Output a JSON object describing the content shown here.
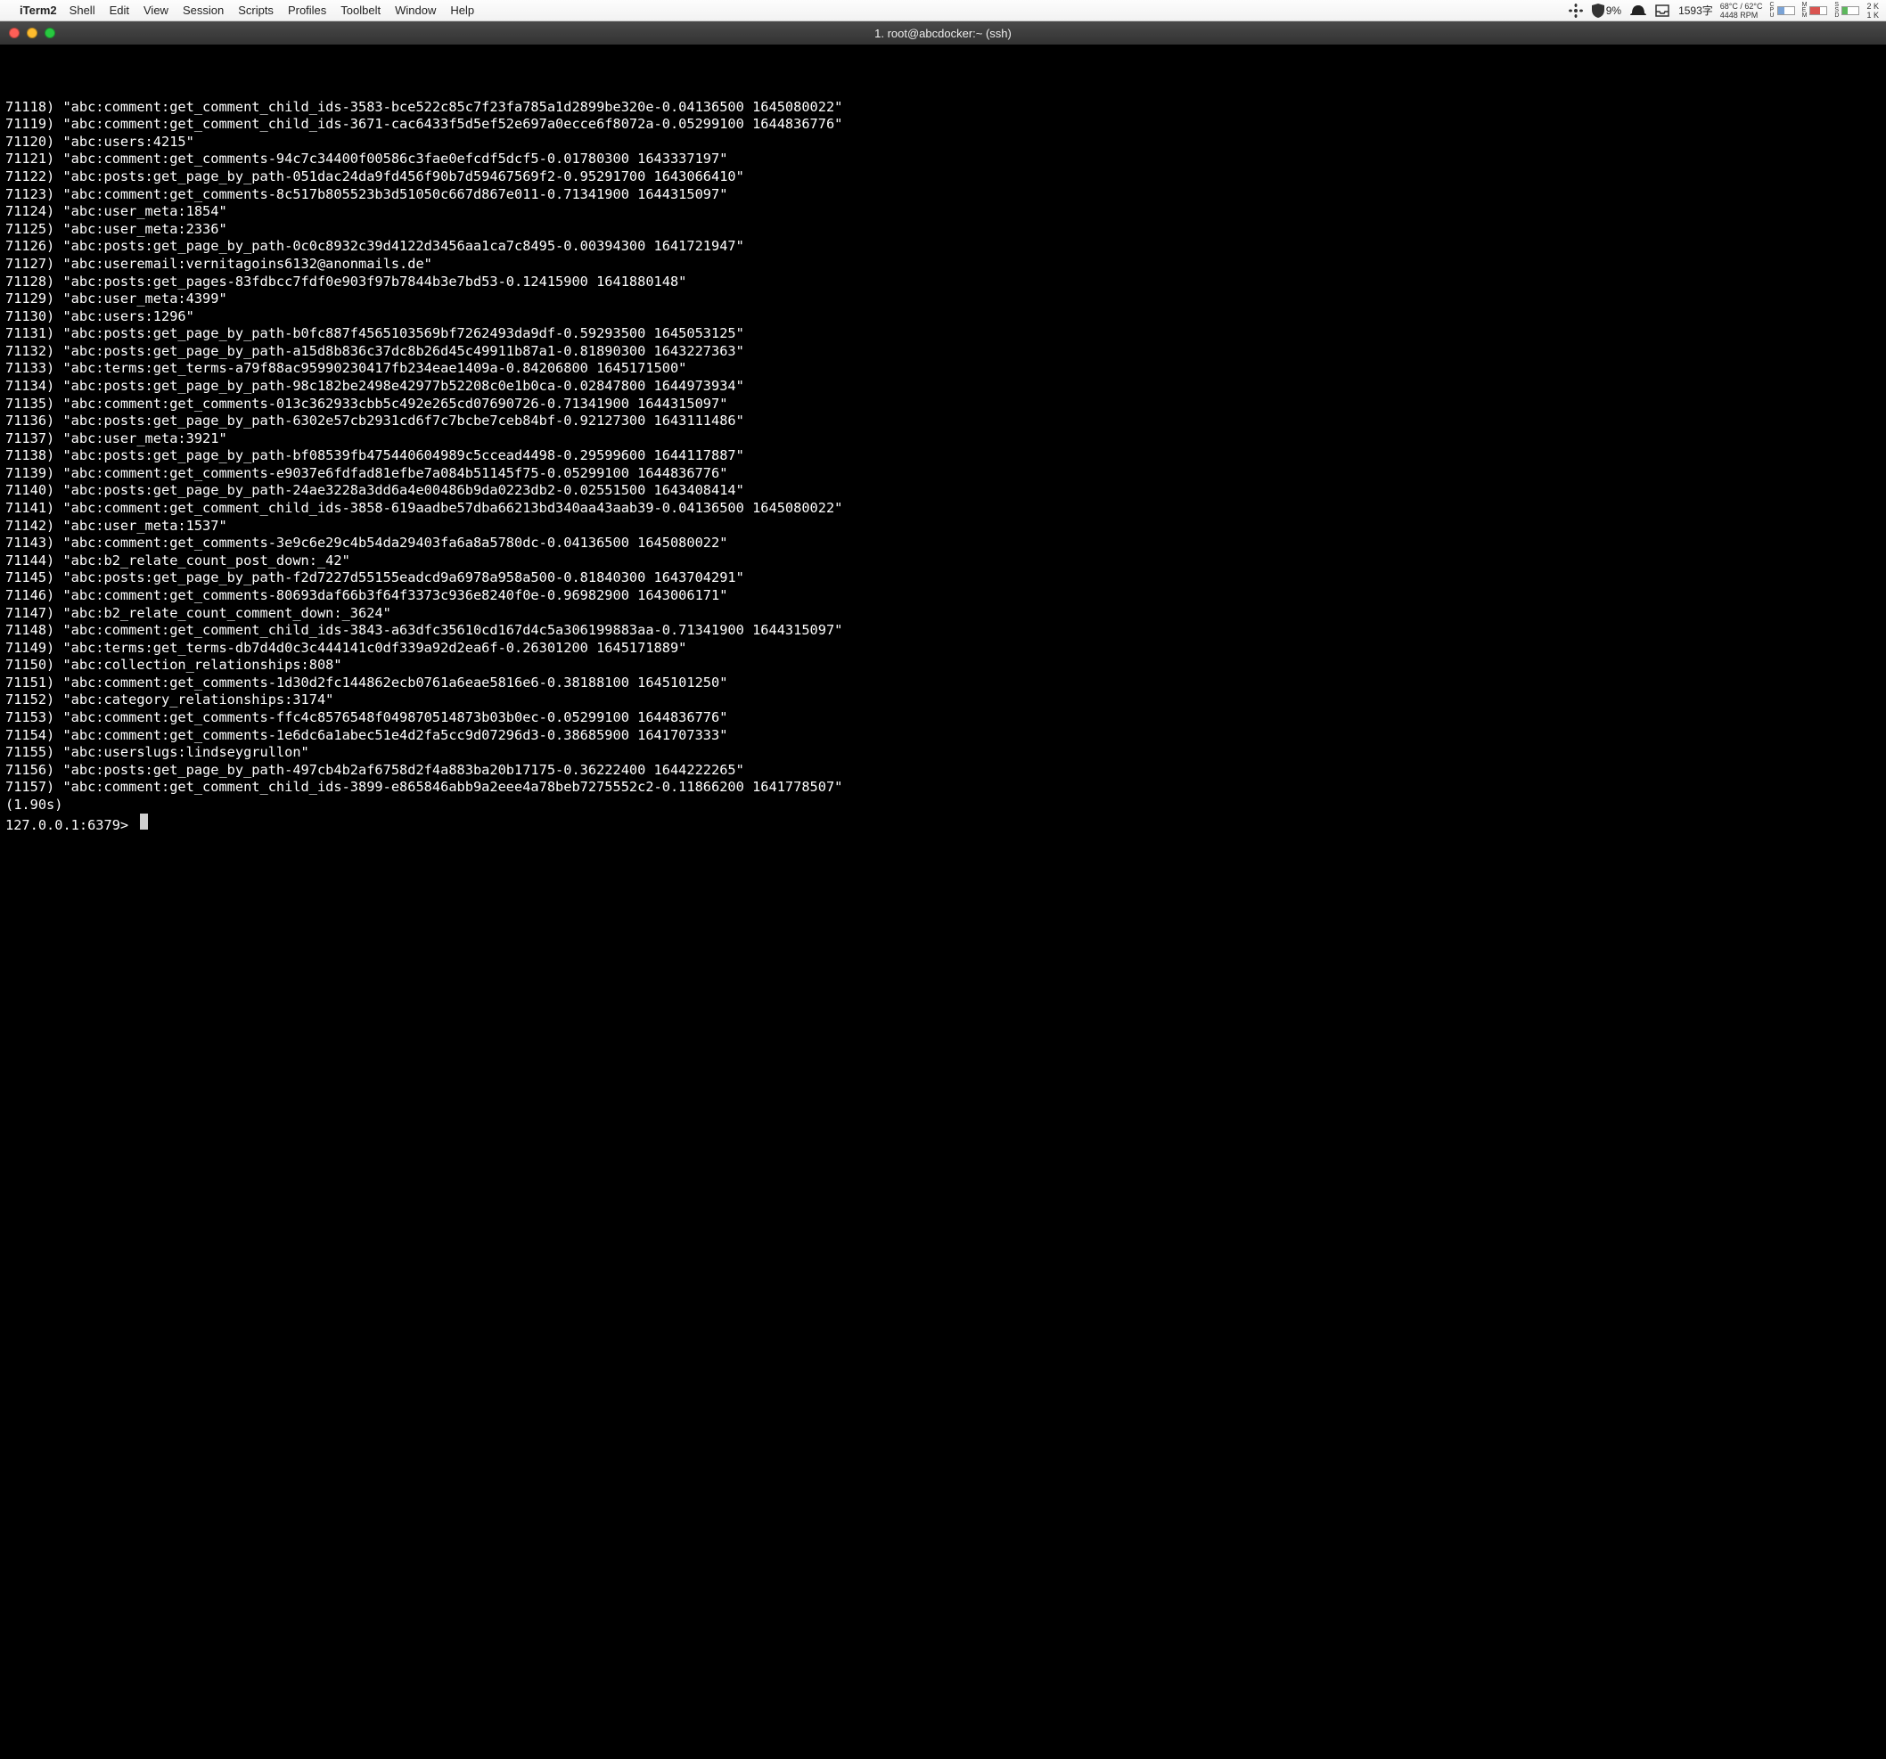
{
  "menubar": {
    "apple": "",
    "app_name": "iTerm2",
    "items": [
      "Shell",
      "Edit",
      "View",
      "Session",
      "Scripts",
      "Profiles",
      "Toolbelt",
      "Window",
      "Help"
    ],
    "status": {
      "fan_icon": "fan",
      "shield_pct": "9%",
      "hat_icon": "hat",
      "inbox_icon": "inbox",
      "char_count": "1593字",
      "temp_top": "68°C / 62°C",
      "temp_bottom": "4448 RPM",
      "cpu_label": "C\nP\nU",
      "mem_label": "M\nE\nM",
      "ssd_label": "S\nS\nD",
      "net_label": "N",
      "net_top": "2 K",
      "net_bottom": "1 K"
    }
  },
  "window": {
    "title": "1. root@abcdocker:~ (ssh)"
  },
  "terminal": {
    "lines": [
      {
        "n": "71118",
        "v": "\"abc:comment:get_comment_child_ids-3583-bce522c85c7f23fa785a1d2899be320e-0.04136500 1645080022\""
      },
      {
        "n": "71119",
        "v": "\"abc:comment:get_comment_child_ids-3671-cac6433f5d5ef52e697a0ecce6f8072a-0.05299100 1644836776\""
      },
      {
        "n": "71120",
        "v": "\"abc:users:4215\""
      },
      {
        "n": "71121",
        "v": "\"abc:comment:get_comments-94c7c34400f00586c3fae0efcdf5dcf5-0.01780300 1643337197\""
      },
      {
        "n": "71122",
        "v": "\"abc:posts:get_page_by_path-051dac24da9fd456f90b7d59467569f2-0.95291700 1643066410\""
      },
      {
        "n": "71123",
        "v": "\"abc:comment:get_comments-8c517b805523b3d51050c667d867e011-0.71341900 1644315097\""
      },
      {
        "n": "71124",
        "v": "\"abc:user_meta:1854\""
      },
      {
        "n": "71125",
        "v": "\"abc:user_meta:2336\""
      },
      {
        "n": "71126",
        "v": "\"abc:posts:get_page_by_path-0c0c8932c39d4122d3456aa1ca7c8495-0.00394300 1641721947\""
      },
      {
        "n": "71127",
        "v": "\"abc:useremail:vernitagoins6132@anonmails.de\""
      },
      {
        "n": "71128",
        "v": "\"abc:posts:get_pages-83fdbcc7fdf0e903f97b7844b3e7bd53-0.12415900 1641880148\""
      },
      {
        "n": "71129",
        "v": "\"abc:user_meta:4399\""
      },
      {
        "n": "71130",
        "v": "\"abc:users:1296\""
      },
      {
        "n": "71131",
        "v": "\"abc:posts:get_page_by_path-b0fc887f4565103569bf7262493da9df-0.59293500 1645053125\""
      },
      {
        "n": "71132",
        "v": "\"abc:posts:get_page_by_path-a15d8b836c37dc8b26d45c49911b87a1-0.81890300 1643227363\""
      },
      {
        "n": "71133",
        "v": "\"abc:terms:get_terms-a79f88ac95990230417fb234eae1409a-0.84206800 1645171500\""
      },
      {
        "n": "71134",
        "v": "\"abc:posts:get_page_by_path-98c182be2498e42977b52208c0e1b0ca-0.02847800 1644973934\""
      },
      {
        "n": "71135",
        "v": "\"abc:comment:get_comments-013c362933cbb5c492e265cd07690726-0.71341900 1644315097\""
      },
      {
        "n": "71136",
        "v": "\"abc:posts:get_page_by_path-6302e57cb2931cd6f7c7bcbe7ceb84bf-0.92127300 1643111486\""
      },
      {
        "n": "71137",
        "v": "\"abc:user_meta:3921\""
      },
      {
        "n": "71138",
        "v": "\"abc:posts:get_page_by_path-bf08539fb475440604989c5ccead4498-0.29599600 1644117887\""
      },
      {
        "n": "71139",
        "v": "\"abc:comment:get_comments-e9037e6fdfad81efbe7a084b51145f75-0.05299100 1644836776\""
      },
      {
        "n": "71140",
        "v": "\"abc:posts:get_page_by_path-24ae3228a3dd6a4e00486b9da0223db2-0.02551500 1643408414\""
      },
      {
        "n": "71141",
        "v": "\"abc:comment:get_comment_child_ids-3858-619aadbe57dba66213bd340aa43aab39-0.04136500 1645080022\""
      },
      {
        "n": "71142",
        "v": "\"abc:user_meta:1537\""
      },
      {
        "n": "71143",
        "v": "\"abc:comment:get_comments-3e9c6e29c4b54da29403fa6a8a5780dc-0.04136500 1645080022\""
      },
      {
        "n": "71144",
        "v": "\"abc:b2_relate_count_post_down:_42\""
      },
      {
        "n": "71145",
        "v": "\"abc:posts:get_page_by_path-f2d7227d55155eadcd9a6978a958a500-0.81840300 1643704291\""
      },
      {
        "n": "71146",
        "v": "\"abc:comment:get_comments-80693daf66b3f64f3373c936e8240f0e-0.96982900 1643006171\""
      },
      {
        "n": "71147",
        "v": "\"abc:b2_relate_count_comment_down:_3624\""
      },
      {
        "n": "71148",
        "v": "\"abc:comment:get_comment_child_ids-3843-a63dfc35610cd167d4c5a306199883aa-0.71341900 1644315097\""
      },
      {
        "n": "71149",
        "v": "\"abc:terms:get_terms-db7d4d0c3c444141c0df339a92d2ea6f-0.26301200 1645171889\""
      },
      {
        "n": "71150",
        "v": "\"abc:collection_relationships:808\""
      },
      {
        "n": "71151",
        "v": "\"abc:comment:get_comments-1d30d2fc144862ecb0761a6eae5816e6-0.38188100 1645101250\""
      },
      {
        "n": "71152",
        "v": "\"abc:category_relationships:3174\""
      },
      {
        "n": "71153",
        "v": "\"abc:comment:get_comments-ffc4c8576548f049870514873b03b0ec-0.05299100 1644836776\""
      },
      {
        "n": "71154",
        "v": "\"abc:comment:get_comments-1e6dc6a1abec51e4d2fa5cc9d07296d3-0.38685900 1641707333\""
      },
      {
        "n": "71155",
        "v": "\"abc:userslugs:lindseygrullon\""
      },
      {
        "n": "71156",
        "v": "\"abc:posts:get_page_by_path-497cb4b2af6758d2f4a883ba20b17175-0.36222400 1644222265\""
      },
      {
        "n": "71157",
        "v": "\"abc:comment:get_comment_child_ids-3899-e865846abb9a2eee4a78beb7275552c2-0.11866200 1641778507\""
      }
    ],
    "elapsed": "(1.90s)",
    "prompt": "127.0.0.1:6379> "
  }
}
